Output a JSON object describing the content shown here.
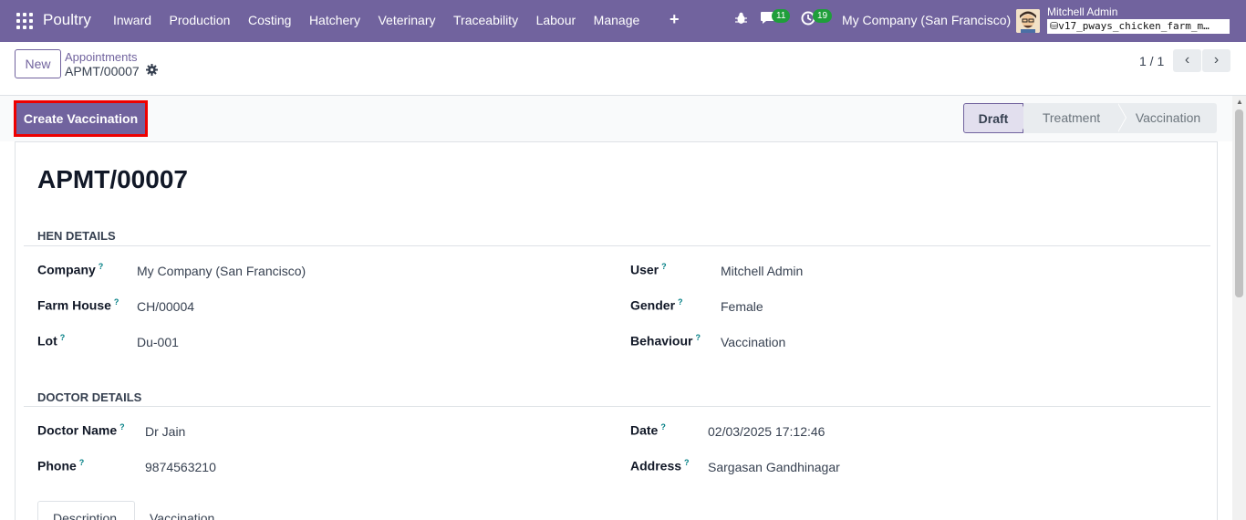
{
  "navbar": {
    "app_name": "Poultry",
    "menu": [
      "Inward",
      "Production",
      "Costing",
      "Hatchery",
      "Veterinary",
      "Traceability",
      "Labour",
      "Manage"
    ],
    "plus": "+",
    "chat_badge": "11",
    "activity_badge": "19",
    "company": "My Company (San Francisco)",
    "user": "Mitchell Admin",
    "database": "v17_pways_chicken_farm_m…"
  },
  "control": {
    "new_label": "New",
    "breadcrumb_parent": "Appointments",
    "breadcrumb_current": "APMT/00007",
    "pager": "1 / 1"
  },
  "status": {
    "create_button": "Create Vaccination",
    "stages": [
      "Draft",
      "Treatment",
      "Vaccination"
    ],
    "active_stage": "Draft"
  },
  "form": {
    "title": "APMT/00007",
    "hen_section": "HEN DETAILS",
    "hen_left": [
      {
        "label": "Company",
        "value": "My Company (San Francisco)"
      },
      {
        "label": "Farm House",
        "value": "CH/00004"
      },
      {
        "label": "Lot",
        "value": "Du-001"
      }
    ],
    "hen_right": [
      {
        "label": "User",
        "value": "Mitchell Admin"
      },
      {
        "label": "Gender",
        "value": "Female"
      },
      {
        "label": "Behaviour",
        "value": "Vaccination"
      }
    ],
    "doctor_section": "DOCTOR DETAILS",
    "doctor_left": [
      {
        "label": "Doctor Name",
        "value": "Dr Jain"
      },
      {
        "label": "Phone",
        "value": "9874563210"
      }
    ],
    "doctor_right": [
      {
        "label": "Date",
        "value": "02/03/2025 17:12:46"
      },
      {
        "label": "Address",
        "value": "Sargasan Gandhinagar"
      }
    ],
    "help_mark": "?",
    "tabs": [
      "Description",
      "Vaccination"
    ]
  },
  "colors": {
    "brand": "#71639e",
    "badge_green": "#1f9e3b",
    "highlight_red": "#ee0000"
  }
}
